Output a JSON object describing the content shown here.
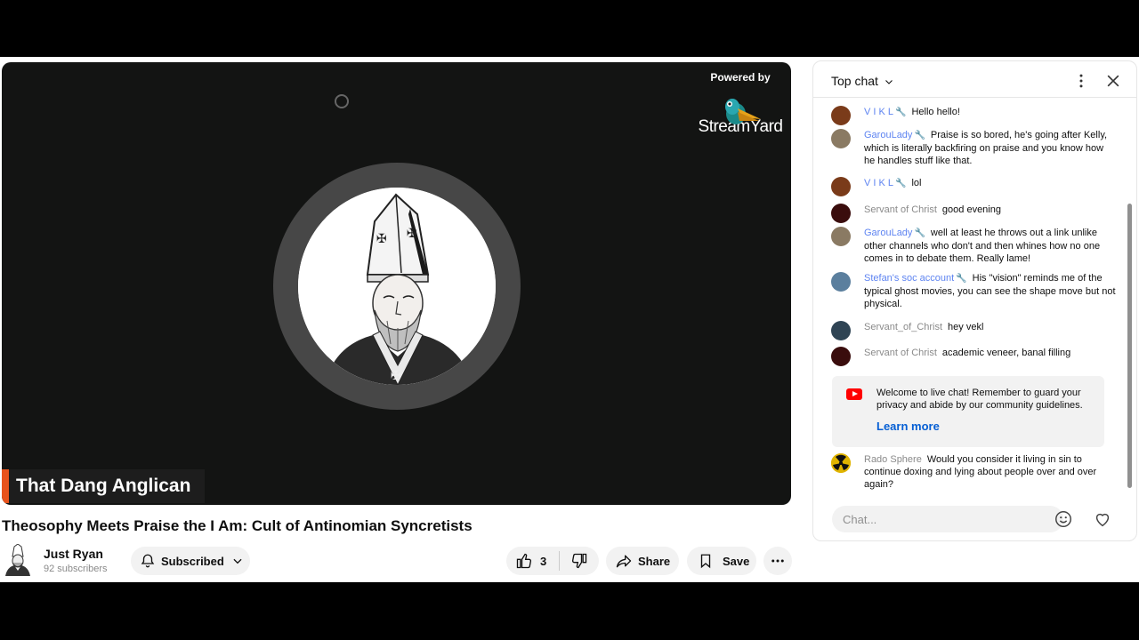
{
  "video": {
    "powered_by": "Powered by",
    "brand": "StreamYard",
    "lower_third": "That Dang Anglican"
  },
  "title": "Theosophy Meets Praise the I Am: Cult of Antinomian Syncretists",
  "channel": {
    "name": "Just Ryan",
    "subscribers": "92 subscribers",
    "subscribe_label": "Subscribed"
  },
  "actions": {
    "like_count": "3",
    "share_label": "Share",
    "save_label": "Save"
  },
  "chat": {
    "header": "Top chat",
    "messages": [
      {
        "author": "V I K L",
        "mod": true,
        "text": "Hello hello!",
        "avatar_color": "#7a3b1a"
      },
      {
        "author": "GarouLady",
        "mod": true,
        "text": "Praise is so bored, he's going after Kelly, which is literally backfiring on praise and you know how he handles stuff like that.",
        "avatar_color": "#8a7a63"
      },
      {
        "author": "V I K L",
        "mod": true,
        "text": "lol",
        "avatar_color": "#7a3b1a"
      },
      {
        "author": "Servant of Christ",
        "mod": false,
        "text": "good evening",
        "avatar_color": "#3a0d0d"
      },
      {
        "author": "GarouLady",
        "mod": true,
        "text": "well at least he throws out a link unlike other channels who don't and then whines how no one comes in to debate them. Really lame!",
        "avatar_color": "#8a7a63"
      },
      {
        "author": "Stefan's soc account",
        "mod": true,
        "text": "His \"vision\" reminds me of the typical ghost movies, you can see the shape move but not physical.",
        "avatar_color": "#5b7f9e"
      },
      {
        "author": "Servant_of_Christ",
        "mod": false,
        "text": "hey vekl",
        "avatar_color": "#2f4454"
      },
      {
        "author": "Servant of Christ",
        "mod": false,
        "text": "academic veneer, banal filling",
        "avatar_color": "#3a0d0d"
      },
      {
        "author": "Rado Sphere",
        "mod": false,
        "text": "Would you consider it living in sin to continue doxing and lying about people over and over again?",
        "avatar_color": "#e0b400"
      }
    ],
    "welcome_text": "Welcome to live chat! Remember to guard your privacy and abide by our community guidelines.",
    "learn_more": "Learn more",
    "input_placeholder": "Chat..."
  },
  "colors": {
    "accent_bar": "#e8531c",
    "mod_name": "#5e84f1",
    "link": "#065fd4"
  }
}
